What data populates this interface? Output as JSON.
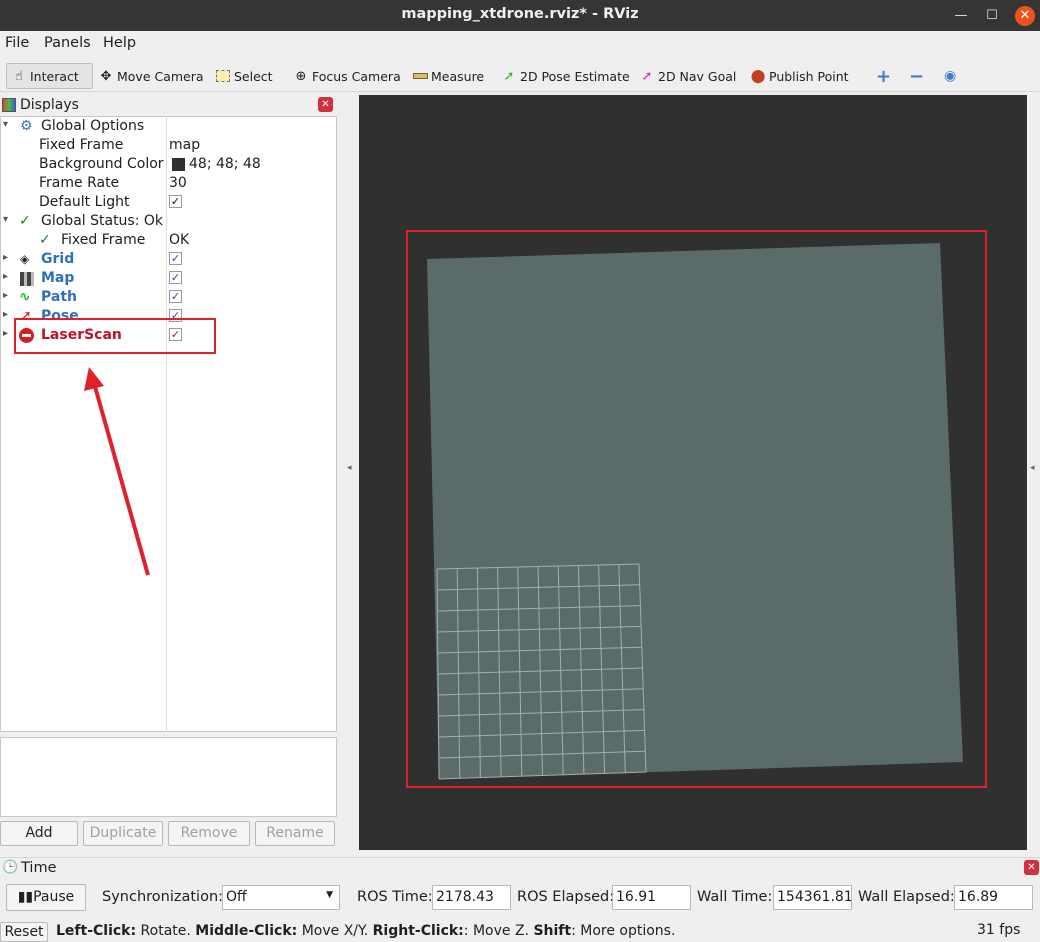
{
  "window": {
    "title": "mapping_xtdrone.rviz* - RViz"
  },
  "menu": {
    "file": "File",
    "panels": "Panels",
    "help": "Help"
  },
  "toolbar": {
    "interact": "Interact",
    "move_camera": "Move Camera",
    "select": "Select",
    "focus_camera": "Focus Camera",
    "measure": "Measure",
    "pose_estimate": "2D Pose Estimate",
    "nav_goal": "2D Nav Goal",
    "publish_point": "Publish Point"
  },
  "displays": {
    "title": "Displays",
    "global_options": {
      "label": "Global Options",
      "fixed_frame_label": "Fixed Frame",
      "fixed_frame_value": "map",
      "background_color_label": "Background Color",
      "background_color_value": "48; 48; 48",
      "frame_rate_label": "Frame Rate",
      "frame_rate_value": "30",
      "default_light_label": "Default Light"
    },
    "global_status": {
      "label": "Global Status: Ok",
      "fixed_frame_label": "Fixed Frame",
      "fixed_frame_value": "OK"
    },
    "items": [
      {
        "label": "Grid",
        "enabled": true
      },
      {
        "label": "Map",
        "enabled": true
      },
      {
        "label": "Path",
        "enabled": true
      },
      {
        "label": "Pose",
        "enabled": true
      },
      {
        "label": "LaserScan",
        "enabled": true,
        "status": "error"
      }
    ],
    "buttons": {
      "add": "Add",
      "duplicate": "Duplicate",
      "remove": "Remove",
      "rename": "Rename"
    }
  },
  "time_panel": {
    "title": "Time",
    "pause": "Pause",
    "sync_label": "Synchronization:",
    "sync_value": "Off",
    "ros_time_label": "ROS Time:",
    "ros_time": "2178.43",
    "ros_elapsed_label": "ROS Elapsed:",
    "ros_elapsed": "16.91",
    "wall_time_label": "Wall Time:",
    "wall_time": "154361.81",
    "wall_elapsed_label": "Wall Elapsed:",
    "wall_elapsed": "16.89"
  },
  "status_bar": {
    "reset": "Reset",
    "left_click_key": "Left-Click:",
    "left_click_text": " Rotate. ",
    "middle_click_key": "Middle-Click:",
    "middle_click_text": " Move X/Y. ",
    "right_click_key": "Right-Click:",
    "right_click_text": ": Move Z. ",
    "shift_key": "Shift",
    "shift_text": ": More options.",
    "fps": "31 fps"
  },
  "colors": {
    "viewport_bg": "#303030",
    "map_fill": "#5b6b69",
    "annotation": "#e0202a",
    "link_blue": "#2f6fbf",
    "error_red": "#c0102a"
  }
}
